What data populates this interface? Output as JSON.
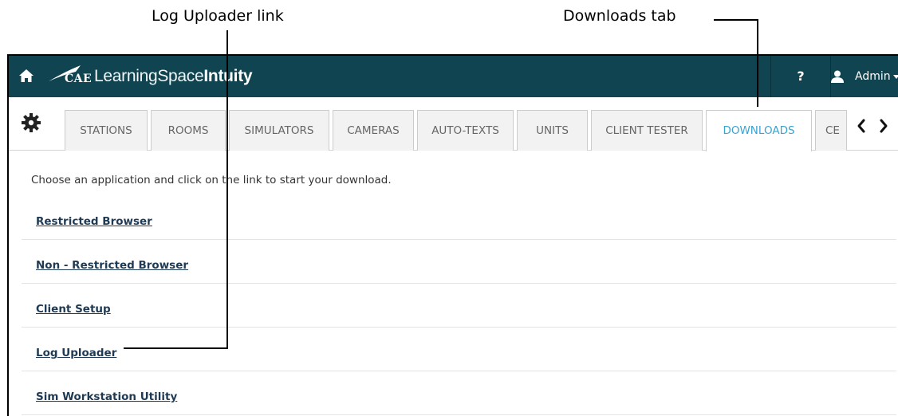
{
  "callouts": {
    "log_uploader_link": "Log Uploader link",
    "downloads_tab": "Downloads tab"
  },
  "topbar": {
    "brand_mark": "CAE",
    "brand_name_light": "LearningSpace",
    "brand_name_bold": "Intuity",
    "help_label": "?",
    "user_label": "Admin",
    "icons": [
      "home-icon",
      "user-icon",
      "caret-down-icon"
    ],
    "background_color": "#0f4450"
  },
  "tabbar": {
    "tabs": [
      {
        "label": "STATIONS",
        "active": false
      },
      {
        "label": "ROOMS",
        "active": false
      },
      {
        "label": "SIMULATORS",
        "active": false
      },
      {
        "label": "CAMERAS",
        "active": false
      },
      {
        "label": "AUTO-TEXTS",
        "active": false
      },
      {
        "label": "UNITS",
        "active": false
      },
      {
        "label": "CLIENT TESTER",
        "active": false
      },
      {
        "label": "DOWNLOADS",
        "active": true
      },
      {
        "label": "CE",
        "active": false
      }
    ],
    "icons": [
      "gear-icon",
      "chevron-left-icon",
      "chevron-right-icon"
    ],
    "active_color": "#3ba3d0"
  },
  "downloads": {
    "intro": "Choose an application and click on the link to start your download.",
    "links": [
      "Restricted Browser",
      "Non - Restricted Browser",
      "Client Setup",
      "Log Uploader",
      "Sim Workstation Utility"
    ]
  }
}
